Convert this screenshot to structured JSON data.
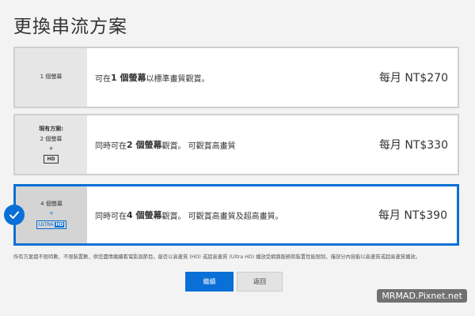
{
  "header": {
    "title": "更換串流方案"
  },
  "plans": [
    {
      "screens": "1 個螢幕",
      "desc_pre": "可在 ",
      "desc_bold": "1 個螢幕",
      "desc_post": "以標準畫質觀賞。",
      "price": "每月 NT$270"
    },
    {
      "current_label": "現有方案:",
      "screens": "2 個螢幕",
      "plus": "+",
      "badge": "HD",
      "desc_pre": "同時可在 ",
      "desc_bold": "2 個螢幕",
      "desc_post": "觀賞。 可觀賞高畫質",
      "price": "每月 NT$330"
    },
    {
      "screens": "4 個螢幕",
      "plus": "+",
      "badge_a": "ULTRA",
      "badge_b": "HD",
      "desc_pre": "同時可在 ",
      "desc_bold": "4 個螢幕",
      "desc_post": "觀賞。 可觀賞高畫質及超高畫質。",
      "price": "每月 NT$390",
      "selected": true
    }
  ],
  "footnote": "所有方案都不限時數、不限裝置數，供您盡情繼續看電影與節目。能否以高畫質 (HD) 或超高畫質 (Ultra HD) 播放受網路服務和裝置性能限制，僅部分內容能以高畫質或超高畫質播放。",
  "buttons": {
    "continue": "繼續",
    "back": "返回"
  },
  "watermark": "MRMAD.Pixnet.net",
  "colors": {
    "accent": "#0a6fd6"
  },
  "icons": {
    "selected": "check-icon"
  }
}
